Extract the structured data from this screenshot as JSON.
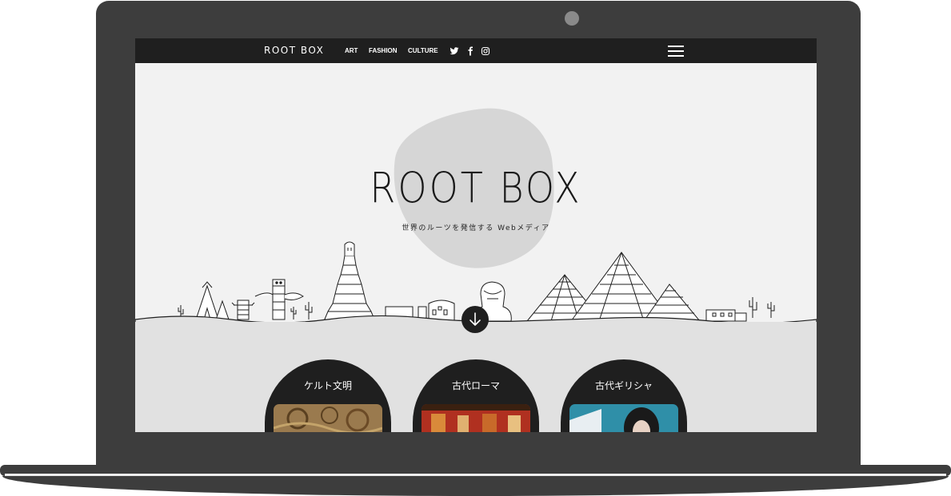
{
  "nav": {
    "logo": "ROOT BOX",
    "links": [
      "ART",
      "FASHION",
      "CULTURE"
    ],
    "social_icons": [
      "twitter-icon",
      "facebook-icon",
      "instagram-icon"
    ],
    "menu_icon": "hamburger-menu-icon"
  },
  "hero": {
    "title": "ROOT BOX",
    "subtitle": "世界のルーツを発信する Webメディア",
    "scroll_icon": "arrow-down-icon"
  },
  "cards": [
    {
      "title": "ケルト文明"
    },
    {
      "title": "古代ローマ"
    },
    {
      "title": "古代ギリシャ"
    }
  ],
  "colors": {
    "frame": "#3d3d3d",
    "nav_bg": "#1f1f1f",
    "hero_bg": "#f2f2f2",
    "blob": "#d6d6d6",
    "lower_bg": "#e1e1e1"
  }
}
